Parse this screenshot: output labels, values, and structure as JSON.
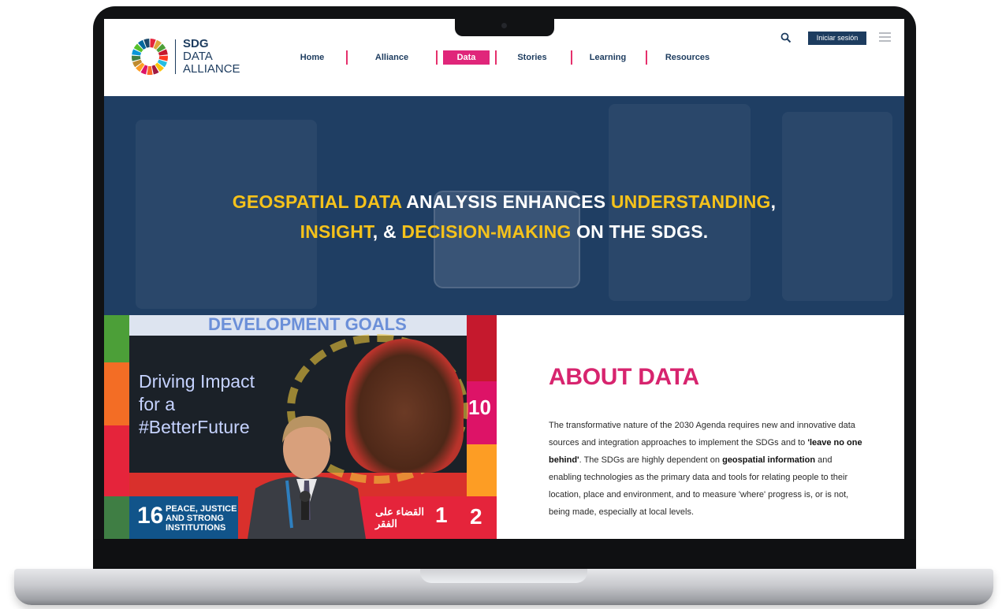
{
  "logo": {
    "line1": "SDG",
    "line2": "DATA",
    "line3": "ALLIANCE"
  },
  "nav": {
    "items": [
      {
        "label": "Home"
      },
      {
        "label": "Alliance"
      },
      {
        "label": "Data",
        "active": true
      },
      {
        "label": "Stories"
      },
      {
        "label": "Learning"
      },
      {
        "label": "Resources"
      }
    ],
    "login_label": "Iniciar sesión"
  },
  "icons": {
    "search": "search-icon",
    "menu": "hamburger-menu-icon",
    "logo": "sdg-wheel-logo-icon"
  },
  "colors": {
    "brand_navy": "#1d3c5f",
    "accent_pink": "#e0267a",
    "highlight_yellow": "#f5c21b",
    "hero_bg": "#1f3e63"
  },
  "hero": {
    "line1": [
      {
        "text": "GEOSPATIAL DATA",
        "highlight": true
      },
      {
        "text": " ANALYSIS ENHANCES ",
        "highlight": false
      },
      {
        "text": "UNDERSTANDING",
        "highlight": true
      },
      {
        "text": ",",
        "highlight": false
      }
    ],
    "line2": [
      {
        "text": "INSIGHT",
        "highlight": true
      },
      {
        "text": ", & ",
        "highlight": false
      },
      {
        "text": "DECISION-MAKING",
        "highlight": true
      },
      {
        "text": " ON THE SDGS.",
        "highlight": false
      }
    ]
  },
  "photo": {
    "banner_text": "DEVELOPMENT GOALS",
    "screen_text": [
      "Driving Impact",
      "for a",
      "#BetterFuture"
    ],
    "tile16_number": "16",
    "tile16_text": [
      "PEACE, JUSTICE",
      "AND STRONG",
      "INSTITUTIONS"
    ],
    "arabic_text": [
      "القضاء على",
      "الفقر"
    ],
    "tile_number": "1",
    "tile_number_2": "2",
    "tile_number_10": "10"
  },
  "about": {
    "title": "ABOUT DATA",
    "p1": "The transformative nature of the 2030 Agenda requires new and innovative data sources and integration approaches to implement the SDGs and to ",
    "b1": "'leave no one behind'",
    "p2": ". The SDGs are highly dependent on ",
    "b2": "geospatial information",
    "p3": " and enabling technologies as the primary data and tools for relating people to their location, place and environment, and to measure 'where' progress is, or is not, being made, especially at local levels."
  }
}
